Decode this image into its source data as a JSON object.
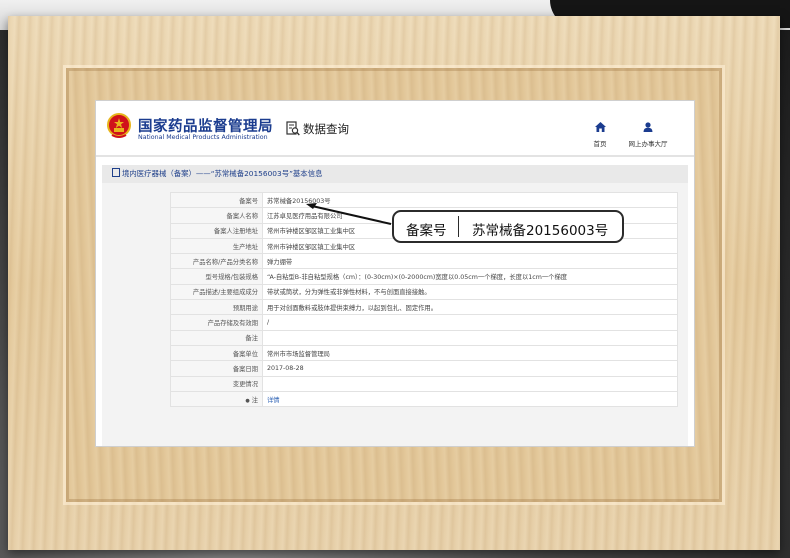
{
  "header": {
    "site_title": "国家药品监督管理局",
    "site_subtitle": "National Medical Products Administration",
    "query_label": "数据查询",
    "nav": [
      {
        "label": "首页",
        "icon": "home-icon"
      },
      {
        "label": "网上办事大厅",
        "icon": "user-icon"
      }
    ]
  },
  "panel": {
    "title": "境内医疗器械（备案）——“苏常械备20156003号”基本信息"
  },
  "rows": [
    {
      "label": "备案号",
      "value": "苏常械备20156003号"
    },
    {
      "label": "备案人名称",
      "value": "江苏卓见医疗用品有限公司"
    },
    {
      "label": "备案人注册地址",
      "value": "常州市钟楼区邹区镇工业集中区"
    },
    {
      "label": "生产地址",
      "value": "常州市钟楼区邹区镇工业集中区"
    },
    {
      "label": "产品名称/产品分类名称",
      "value": "弹力绷带"
    },
    {
      "label": "型号规格/包装规格",
      "value": "“A-自粘型B-非自粘型规格（cm）：(0-30cm)×(0-2000cm)宽度以0.05cm一个梯度，长度以1cm一个梯度"
    },
    {
      "label": "产品描述/主要组成成分",
      "value": "带状或筒状，分为弹性或非弹性材料，不与创面直接接触。"
    },
    {
      "label": "预期用途",
      "value": "用于对创面敷料或肢体提供束缚力，以起到包扎、固定作用。"
    },
    {
      "label": "产品存储及有效期",
      "value": "/"
    },
    {
      "label": "备注",
      "value": ""
    },
    {
      "label": "备案单位",
      "value": "常州市市场监督管理局"
    },
    {
      "label": "备案日期",
      "value": "2017-08-28"
    },
    {
      "label": "变更情况",
      "value": ""
    },
    {
      "label": "注",
      "value": "详情"
    }
  ],
  "callout": {
    "label": "备案号",
    "value": "苏常械备20156003号"
  },
  "colors": {
    "brand_blue": "#1b3c8f",
    "link_blue": "#2f63b5",
    "emblem_red": "#d0121b",
    "emblem_gold": "#e8b51c"
  }
}
